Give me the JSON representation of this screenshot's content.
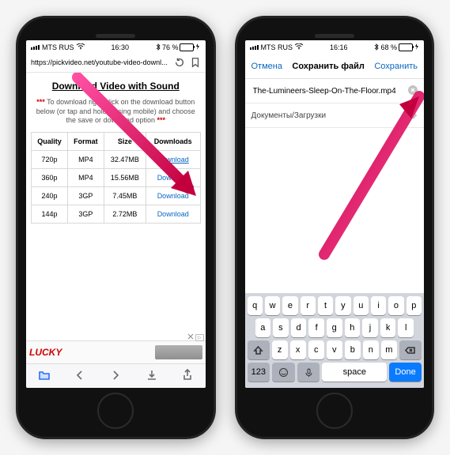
{
  "left": {
    "status": {
      "carrier": "MTS RUS",
      "time": "16:30",
      "battery_text": "76 %",
      "battery_fill": "76%",
      "bt": true
    },
    "url": "https://pickvideo.net/youtube-video-downl...",
    "heading": "Download Video with Sound",
    "instruction_stars": "***",
    "instruction": "To download right-click on the download button below (or tap and hold if using mobile) and choose the save or download option",
    "instruction_stars2": "***",
    "columns": [
      "Quality",
      "Format",
      "Size",
      "Downloads"
    ],
    "rows": [
      {
        "q": "720p",
        "f": "MP4",
        "s": "32.47MB",
        "d": "Download",
        "active": true
      },
      {
        "q": "360p",
        "f": "MP4",
        "s": "15.56MB",
        "d": "Download"
      },
      {
        "q": "240p",
        "f": "3GP",
        "s": "7.45MB",
        "d": "Download"
      },
      {
        "q": "144p",
        "f": "3GP",
        "s": "2.72MB",
        "d": "Download"
      }
    ],
    "ad_brand": "LUCKY"
  },
  "right": {
    "status": {
      "carrier": "MTS RUS",
      "time": "16:16",
      "battery_text": "68 %",
      "battery_fill": "68%",
      "bt": true
    },
    "nav": {
      "cancel": "Отмена",
      "title": "Сохранить файл",
      "save": "Сохранить"
    },
    "filename": "The-Lumineers-Sleep-On-The-Floor.mp4",
    "path": "Документы/Загрузки",
    "keyboard": {
      "row1": [
        "q",
        "w",
        "e",
        "r",
        "t",
        "y",
        "u",
        "i",
        "o",
        "p"
      ],
      "row2": [
        "a",
        "s",
        "d",
        "f",
        "g",
        "h",
        "j",
        "k",
        "l"
      ],
      "row3": [
        "z",
        "x",
        "c",
        "v",
        "b",
        "n",
        "m"
      ],
      "num": "123",
      "space": "space",
      "done": "Done"
    }
  }
}
